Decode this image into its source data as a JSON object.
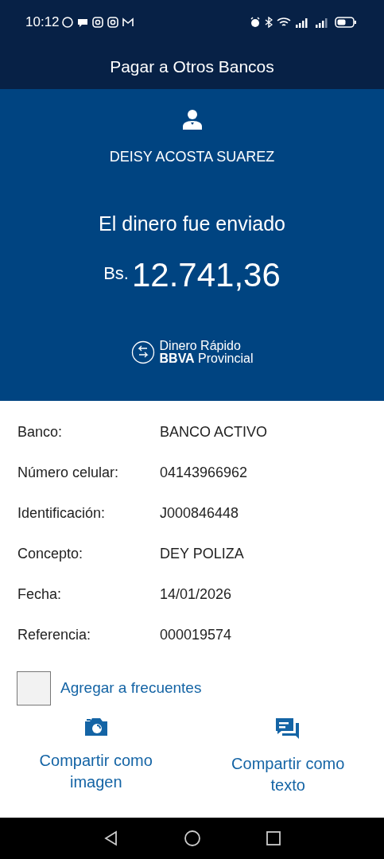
{
  "status_bar": {
    "time": "10:12"
  },
  "header": {
    "title": "Pagar a Otros Bancos"
  },
  "hero": {
    "recipient": "DEISY ACOSTA SUAREZ",
    "message": "El dinero fue enviado",
    "currency": "Bs.",
    "amount": "12.741,36",
    "brand_line_1": "Dinero Rápido",
    "brand_line_2": "**BBVA** Provincial"
  },
  "details": [
    {
      "label": "Banco:",
      "value": "BANCO ACTIVO"
    },
    {
      "label": "Número celular:",
      "value": "04143966962"
    },
    {
      "label": "Identificación:",
      "value": "J000846448"
    },
    {
      "label": "Concepto:",
      "value": "DEY POLIZA"
    },
    {
      "label": "Fecha:",
      "value": "14/01/2026"
    },
    {
      "label": "Referencia:",
      "value": "000019574"
    }
  ],
  "favorite": {
    "label": "Agregar a frecuentes",
    "checked": false
  },
  "share": [
    {
      "kind": "image",
      "label": "Compartir como imagen"
    },
    {
      "kind": "text",
      "label": "Compartir como texto"
    }
  ]
}
